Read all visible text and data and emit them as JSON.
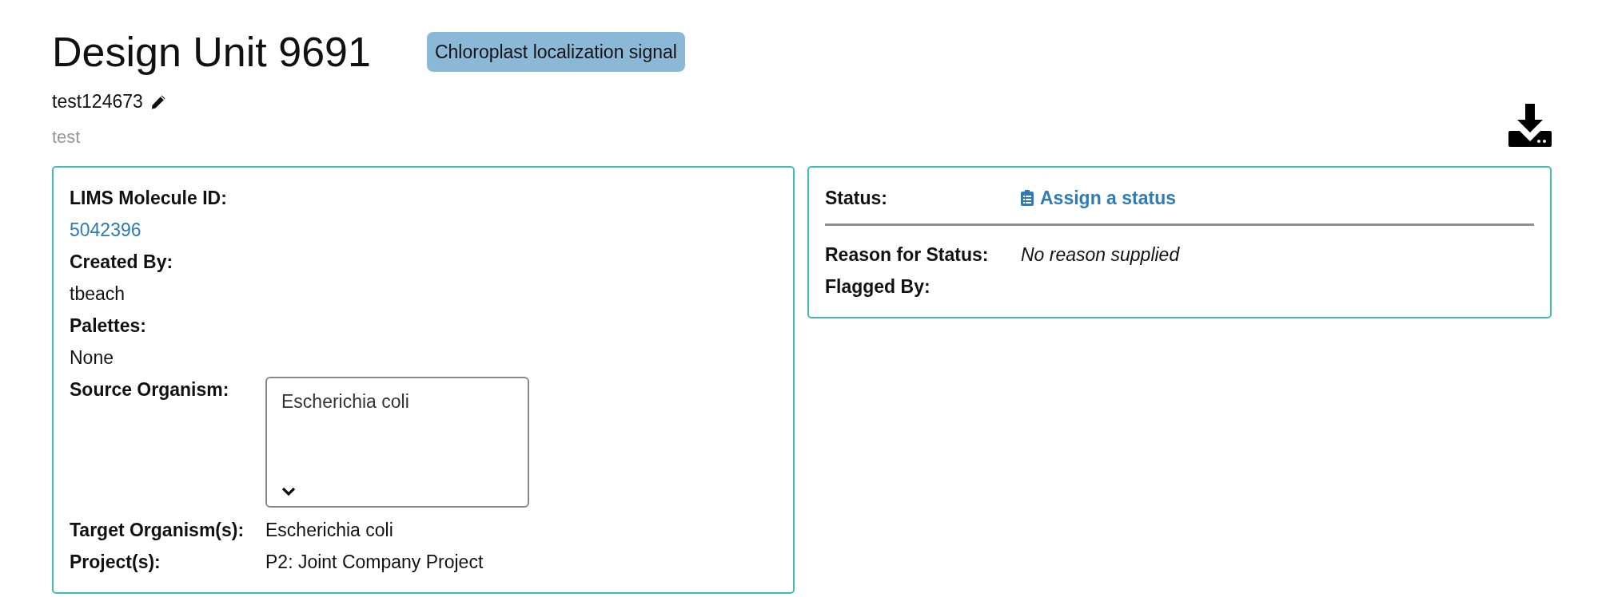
{
  "title": "Design Unit 9691",
  "tag": "Chloroplast localization signal",
  "name": "test124673",
  "description": "test",
  "details": [
    {
      "kind": "stacked",
      "label": "LIMS Molecule ID:",
      "value": "5042396",
      "link": true
    },
    {
      "kind": "stacked",
      "label": "Created By:",
      "value": "tbeach",
      "link": false
    },
    {
      "kind": "stacked",
      "label": "Palettes:",
      "value": "None",
      "link": false
    },
    {
      "kind": "select",
      "label": "Source Organism:",
      "value": "Escherichia coli"
    },
    {
      "kind": "inline",
      "label": "Target Organism(s):",
      "value": "Escherichia coli"
    },
    {
      "kind": "inline",
      "label": "Project(s):",
      "value": "P2: Joint Company Project"
    }
  ],
  "status": {
    "label": "Status:",
    "action": "Assign a status"
  },
  "status_details": [
    {
      "label": "Reason for Status:",
      "value": "No reason supplied",
      "italic": true
    },
    {
      "label": "Flagged By:"
    }
  ]
}
